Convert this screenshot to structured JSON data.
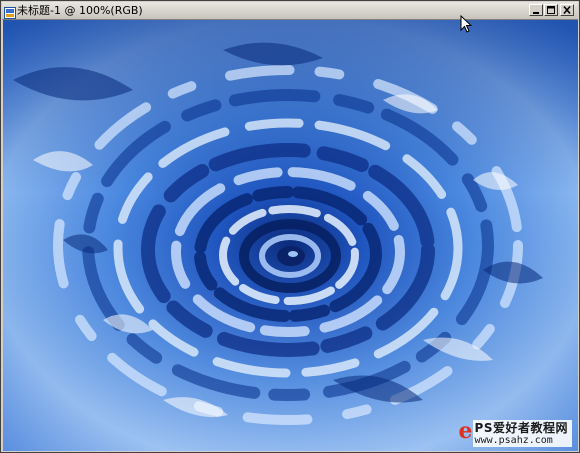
{
  "window": {
    "title": "未标题-1 @ 100%(RGB)",
    "buttons": [
      "minimize",
      "maximize",
      "close"
    ]
  },
  "canvas": {
    "content": "blue water ripple swirl",
    "colors": {
      "deep": "#0a2a7a",
      "mid": "#2f6fd6",
      "light": "#9cc4f4",
      "highlight": "#e8f2ff"
    }
  },
  "watermark": {
    "line1": "PS爱好者教程网",
    "line2": "www.psahz.com"
  },
  "cursor": {
    "icon": "arrow-cursor-icon"
  }
}
